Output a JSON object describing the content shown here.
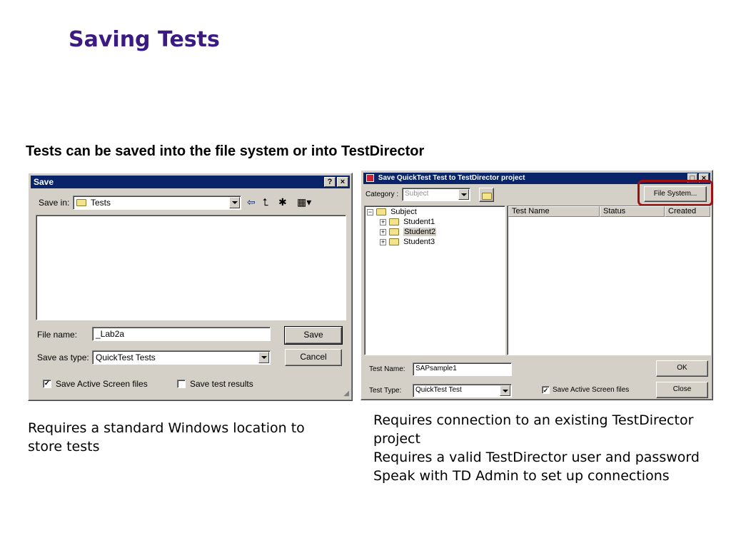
{
  "slide": {
    "title": "Saving Tests",
    "subtitle": "Tests can be saved into the file system or into TestDirector",
    "caption_left": [
      "Requires a standard Windows location to",
      "store tests"
    ],
    "caption_right": [
      "Requires connection to an existing TestDirector",
      "project",
      "Requires a valid TestDirector user and password",
      "Speak with TD Admin to set up connections"
    ]
  },
  "save_dialog": {
    "title": "Save",
    "help_btn": "?",
    "close_btn": "×",
    "save_in_label": "Save in:",
    "save_in_value": "Tests",
    "file_name_label": "File name:",
    "file_name_value": "_Lab2a",
    "save_as_type_label": "Save as type:",
    "save_as_type_value": "QuickTest Tests",
    "save_button": "Save",
    "cancel_button": "Cancel",
    "save_active_screen": "Save Active Screen files",
    "save_active_screen_checked": true,
    "save_test_results": "Save test results",
    "save_test_results_checked": false
  },
  "td_dialog": {
    "title": "Save QuickTest Test to TestDirector project",
    "category_label": "Category :",
    "category_value": "Subject",
    "file_system_button": "File System...",
    "tree": {
      "root": "Subject",
      "children": [
        "Student1",
        "Student2",
        "Student3"
      ]
    },
    "columns": [
      "Test Name",
      "Status",
      "Created"
    ],
    "test_name_label": "Test Name:",
    "test_name_value": "SAPsample1",
    "test_type_label": "Test Type:",
    "test_type_value": "QuickTest Test",
    "save_active_screen": "Save Active Screen files",
    "save_active_screen_checked": true,
    "ok_button": "OK",
    "close_button": "Close"
  },
  "colors": {
    "title": "#3b1a84",
    "titlebar": "#0a246a",
    "highlight_ring": "#a01010"
  }
}
